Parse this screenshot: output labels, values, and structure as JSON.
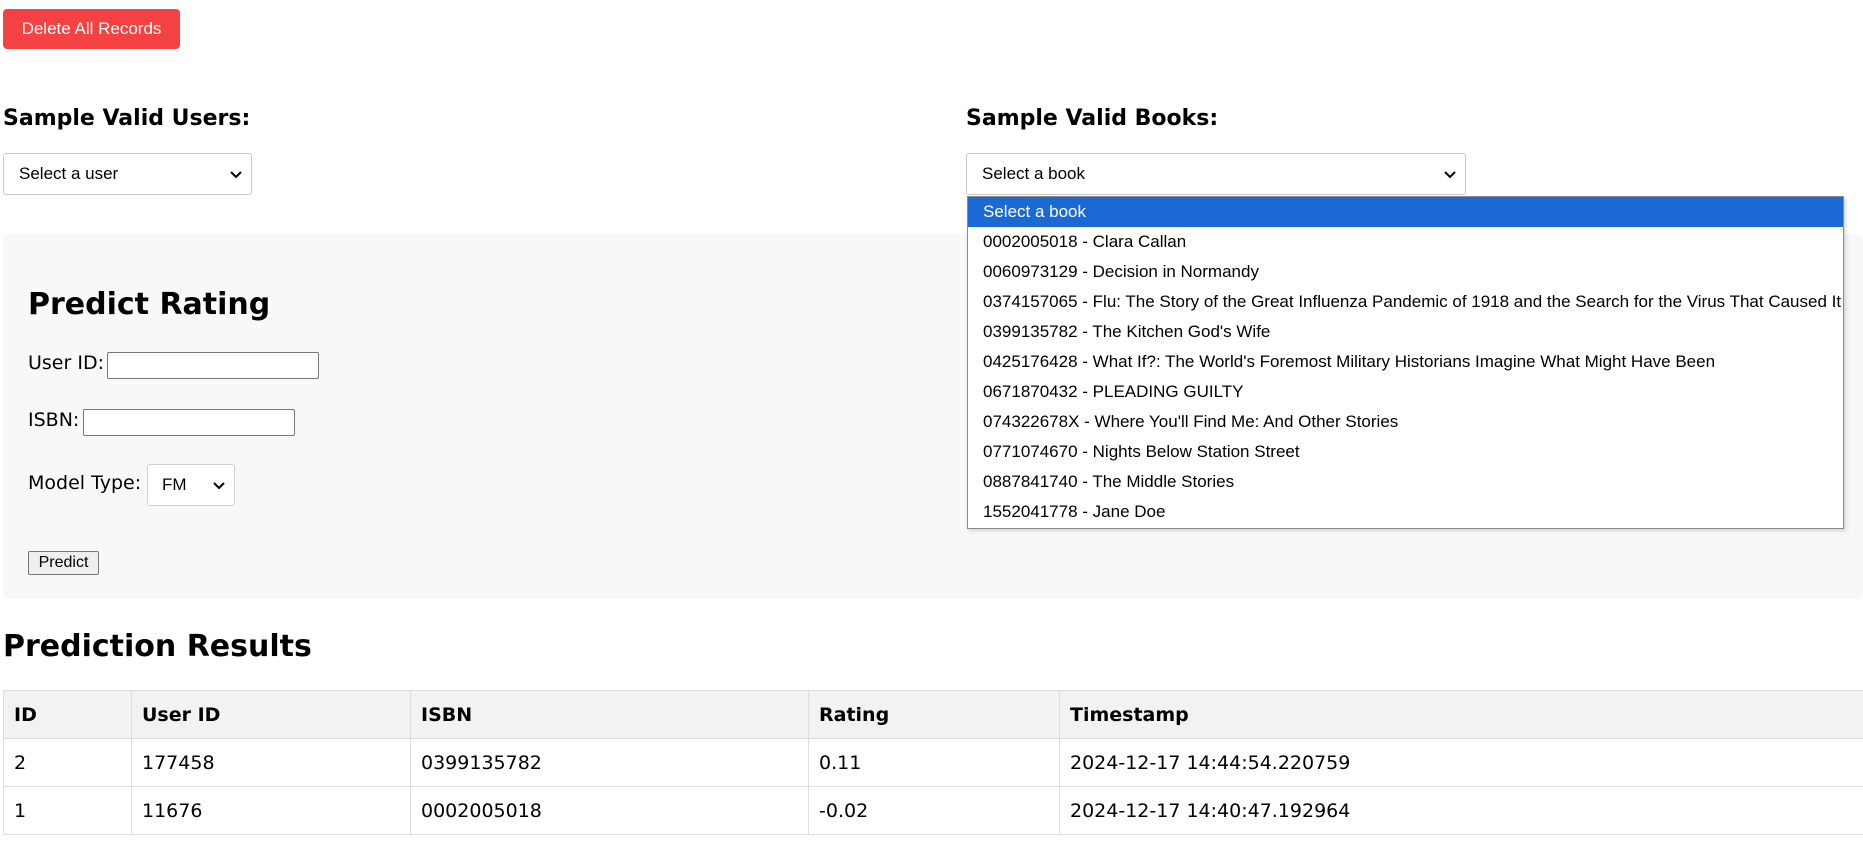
{
  "toolbar": {
    "delete_label": "Delete All Records",
    "delete_color": "#f44242"
  },
  "users_section": {
    "heading": "Sample Valid Users:",
    "select_value": "Select a user"
  },
  "books_section": {
    "heading": "Sample Valid Books:",
    "select_value": "Select a book",
    "dropdown_open": true,
    "options": [
      "Select a book",
      "0002005018 - Clara Callan",
      "0060973129 - Decision in Normandy",
      "0374157065 - Flu: The Story of the Great Influenza Pandemic of 1918 and the Search for the Virus That Caused It",
      "0399135782 - The Kitchen God's Wife",
      "0425176428 - What If?: The World's Foremost Military Historians Imagine What Might Have Been",
      "0671870432 - PLEADING GUILTY",
      "074322678X - Where You'll Find Me: And Other Stories",
      "0771074670 - Nights Below Station Street",
      "0887841740 - The Middle Stories",
      "1552041778 - Jane Doe"
    ],
    "highlight_color": "#1a69d4"
  },
  "predict_form": {
    "title": "Predict Rating",
    "user_id_label": "User ID:",
    "user_id_value": "",
    "isbn_label": "ISBN:",
    "isbn_value": "",
    "model_type_label": "Model Type:",
    "model_type_value": "FM",
    "predict_label": "Predict"
  },
  "results": {
    "title": "Prediction Results",
    "columns": [
      "ID",
      "User ID",
      "ISBN",
      "Rating",
      "Timestamp"
    ],
    "rows": [
      [
        "2",
        "177458",
        "0399135782",
        "0.11",
        "2024-12-17 14:44:54.220759"
      ],
      [
        "1",
        "11676",
        "0002005018",
        "-0.02",
        "2024-12-17 14:40:47.192964"
      ]
    ]
  }
}
